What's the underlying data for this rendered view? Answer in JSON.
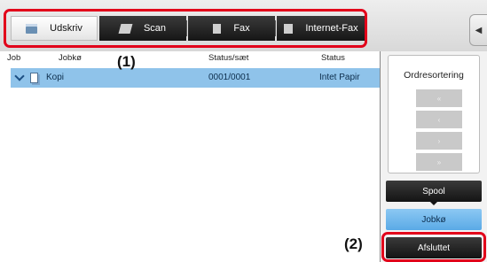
{
  "tabs": [
    {
      "label": "Udskriv",
      "icon": "printer-icon",
      "active": true
    },
    {
      "label": "Scan",
      "icon": "scanner-icon",
      "active": false
    },
    {
      "label": "Fax",
      "icon": "fax-icon",
      "active": false
    },
    {
      "label": "Internet-Fax",
      "icon": "internet-fax-icon",
      "active": false
    }
  ],
  "side_arrow": "◀",
  "callouts": {
    "one": "(1)",
    "two": "(2)"
  },
  "list": {
    "columns": {
      "job": "Job",
      "queue": "Jobkø",
      "status_set": "Status/sæt",
      "status": "Status"
    },
    "rows": [
      {
        "queue": "Kopi",
        "status_set": "0001/0001",
        "status": "Intet Papir"
      }
    ]
  },
  "right_panel": {
    "sort_title": "Ordresortering",
    "sort_buttons": [
      "«",
      "‹",
      "›",
      "»"
    ],
    "spool_label": "Spool",
    "jobqueue_label": "Jobkø",
    "done_label": "Afsluttet"
  },
  "colors": {
    "highlight": "#e2001a",
    "selected_row": "#8fc3ea",
    "active_button": "#5aaae6"
  }
}
